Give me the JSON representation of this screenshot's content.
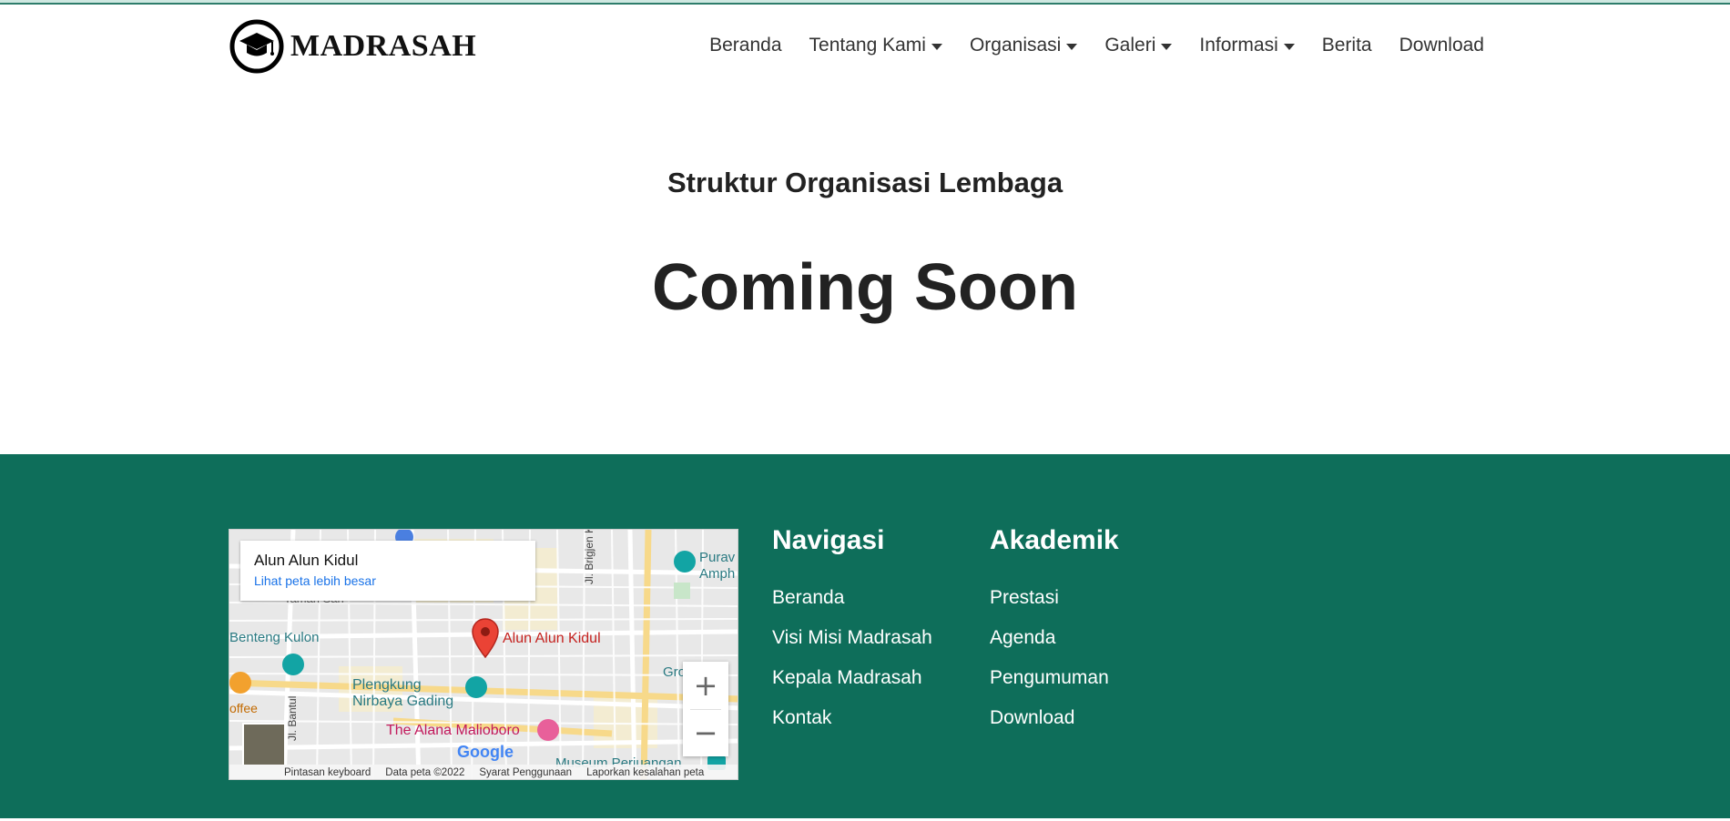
{
  "brand": {
    "name": "MADRASAH"
  },
  "nav": {
    "items": [
      {
        "label": "Beranda",
        "dropdown": false
      },
      {
        "label": "Tentang Kami",
        "dropdown": true
      },
      {
        "label": "Organisasi",
        "dropdown": true
      },
      {
        "label": "Galeri",
        "dropdown": true
      },
      {
        "label": "Informasi",
        "dropdown": true
      },
      {
        "label": "Berita",
        "dropdown": false
      },
      {
        "label": "Download",
        "dropdown": false
      }
    ]
  },
  "main": {
    "subtitle": "Struktur Organisasi Lembaga",
    "title": "Coming Soon"
  },
  "map": {
    "place_title": "Alun Alun Kidul",
    "view_larger_link": "Lihat peta lebih besar",
    "marker_label": "Alun Alun Kidul",
    "labels": {
      "benteng": "Benteng Kulon",
      "plengkung": "Plengkung\nNirbaya Gading",
      "alana": "The Alana Malioboro",
      "museum": "Museum Perjuangan",
      "purawisata": "Purav\nAmph",
      "street_katamso": "Jl. Brigjen Katamso",
      "street_bantul": "Jl. Bantul",
      "taman": "Taman Sari",
      "coffee": "offee",
      "gro": "Gro"
    },
    "zoom_in": "+",
    "zoom_out": "−",
    "footer": {
      "keyboard": "Pintasan keyboard",
      "data": "Data peta ©2022",
      "terms": "Syarat Penggunaan",
      "report": "Laporkan kesalahan peta"
    },
    "google": "Google"
  },
  "footer": {
    "navigasi": {
      "heading": "Navigasi",
      "links": [
        "Beranda",
        "Visi Misi Madrasah",
        "Kepala Madrasah",
        "Kontak"
      ]
    },
    "akademik": {
      "heading": "Akademik",
      "links": [
        "Prestasi",
        "Agenda",
        "Pengumuman",
        "Download"
      ]
    }
  },
  "colors": {
    "footer_bg": "#0e6e5a",
    "map_marker": "#ea4335",
    "link_blue": "#1a73e8"
  }
}
